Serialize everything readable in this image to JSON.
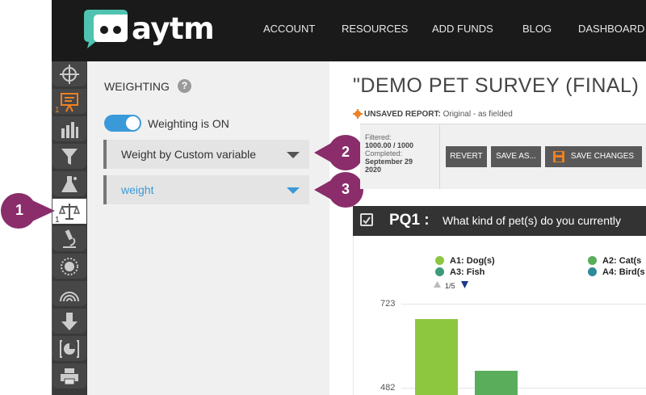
{
  "header": {
    "logo_text": "aytm",
    "nav": [
      "ACCOUNT",
      "RESOURCES",
      "ADD FUNDS",
      "BLOG",
      "DASHBOARD"
    ]
  },
  "iconbar": {
    "items": [
      {
        "icon": "crosshair-icon",
        "badge": ""
      },
      {
        "icon": "presentation-icon",
        "badge": "1"
      },
      {
        "icon": "bar-chart-icon",
        "badge": ""
      },
      {
        "icon": "filter-icon",
        "badge": ""
      },
      {
        "icon": "flask-icon",
        "badge": ""
      },
      {
        "icon": "scales-icon",
        "badge": "1"
      },
      {
        "icon": "microscope-icon",
        "badge": ""
      },
      {
        "icon": "sun-icon",
        "badge": ""
      },
      {
        "icon": "rainbow-icon",
        "badge": ""
      },
      {
        "icon": "download-icon",
        "badge": ""
      },
      {
        "icon": "pie-chart-icon",
        "badge": ""
      },
      {
        "icon": "printer-icon",
        "badge": ""
      }
    ]
  },
  "weighting": {
    "title": "WEIGHTING",
    "help": "?",
    "toggle_label": "Weighting is ON",
    "toggle_on": true,
    "dropdown_method": "Weight by Custom variable",
    "dropdown_variable": "weight"
  },
  "callouts": [
    "1",
    "2",
    "3"
  ],
  "colors": {
    "callout": "#8a2d6a",
    "toggle": "#3a9ad9",
    "link_blue": "#3a9ad9",
    "header_bg": "#1a1a1a",
    "accent_orange": "#f08020"
  },
  "report": {
    "title": "\"DEMO PET SURVEY (FINAL) (24)\"",
    "unsaved_label": "UNSAVED REPORT:",
    "unsaved_value": " Original - as fielded",
    "filtered_label": "Filtered:",
    "filtered_value": "1000.00 / 1000",
    "completed_label": "Completed:",
    "completed_value": "September 29",
    "completed_year": "2020",
    "buttons": {
      "revert": "REVERT",
      "save_as": "SAVE AS...",
      "save_changes": "SAVE CHANGES"
    }
  },
  "question": {
    "label": "PQ1 :",
    "text": "What kind of pet(s) do you currently"
  },
  "chart_data": {
    "type": "bar",
    "legend": [
      {
        "label": "A1: Dog(s)",
        "color": "#8dc63f"
      },
      {
        "label": "A2: Cat(s",
        "color": "#5aad5a"
      },
      {
        "label": "A3: Fish",
        "color": "#3c9a7a"
      },
      {
        "label": "A4: Bird(s",
        "color": "#2f8a9a"
      }
    ],
    "pager": "1/5",
    "y_ticks": [
      "723",
      "482"
    ],
    "categories": [
      "A1: Dog(s)",
      "A2: Cat(s"
    ],
    "values": [
      680,
      530
    ]
  }
}
